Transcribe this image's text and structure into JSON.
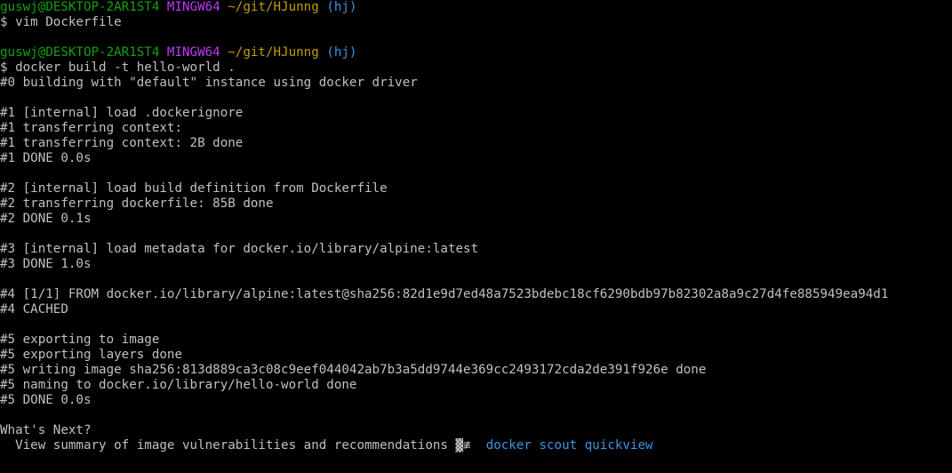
{
  "colors": {
    "background": "#000000",
    "text": "#c0c0c0",
    "user_host": "#13a10e",
    "mingw": "#c239ff",
    "path": "#c19c00",
    "branch": "#3a96dd"
  },
  "prompt1": {
    "user_host": "guswj@DESKTOP-2AR1ST4",
    "env": "MINGW64",
    "path": "~/git/HJunng",
    "branch": "(hj)",
    "command": "$ vim Dockerfile"
  },
  "prompt2": {
    "user_host": "guswj@DESKTOP-2AR1ST4",
    "env": "MINGW64",
    "path": "~/git/HJunng",
    "branch": "(hj)",
    "command": "$ docker build -t hello-world ."
  },
  "output": {
    "l0": "#0 building with \"default\" instance using docker driver",
    "s1": [
      "#1 [internal] load .dockerignore",
      "#1 transferring context:",
      "#1 transferring context: 2B done",
      "#1 DONE 0.0s"
    ],
    "s2": [
      "#2 [internal] load build definition from Dockerfile",
      "#2 transferring dockerfile: 85B done",
      "#2 DONE 0.1s"
    ],
    "s3": [
      "#3 [internal] load metadata for docker.io/library/alpine:latest",
      "#3 DONE 1.0s"
    ],
    "s4": [
      "#4 [1/1] FROM docker.io/library/alpine:latest@sha256:82d1e9d7ed48a7523bdebc18cf6290bdb97b82302a8a9c27d4fe885949ea94d1",
      "#4 CACHED"
    ],
    "s5": [
      "#5 exporting to image",
      "#5 exporting layers done",
      "#5 writing image sha256:813d889ca3c08c9eef044042ab7b3a5dd9744e369cc2493172cda2de391f926e done",
      "#5 naming to docker.io/library/hello-world done",
      "#5 DONE 0.0s"
    ]
  },
  "whats_next": {
    "title": "What's Next?",
    "text": "  View summary of image vulnerabilities and recommendations ",
    "arrow": "▓≢",
    "command": "docker scout quickview"
  }
}
